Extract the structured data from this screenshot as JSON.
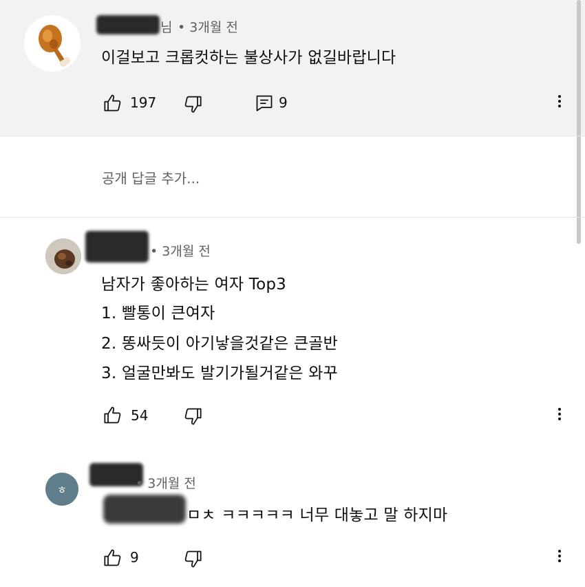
{
  "comments": [
    {
      "time": "• 3개월 전",
      "author_suffix": "님",
      "body_lines": [
        "이걸보고 크롭컷하는 불상사가 없길바랍니다"
      ],
      "likes": "197",
      "replies": "9"
    },
    {
      "time": "• 3개월 전",
      "body_lines": [
        "남자가 좋아하는 여자 Top3",
        "1. 빨통이 큰여자",
        "2. 똥싸듯이 아기낳을것같은 큰골반",
        "3. 얼굴만봐도 발기가될거같은 와꾸"
      ],
      "likes": "54"
    },
    {
      "avatar_letter": "ㅎ",
      "time": "• 3개월 전",
      "body_lines": [
        "ㅁㅊ ㅋㅋㅋㅋㅋ 너무 대놓고 말 하지마"
      ],
      "likes": "9"
    }
  ],
  "reply_box": {
    "placeholder": "공개 답글 추가..."
  },
  "icons": {
    "like": "thumbs-up-icon",
    "dislike": "thumbs-down-icon",
    "replies": "comment-icon",
    "more": "more-vert-icon"
  },
  "colors": {
    "highlight_bg": "#f2f2f2",
    "meta_text": "#606060",
    "letter_avatar_bg": "#607d8b"
  }
}
